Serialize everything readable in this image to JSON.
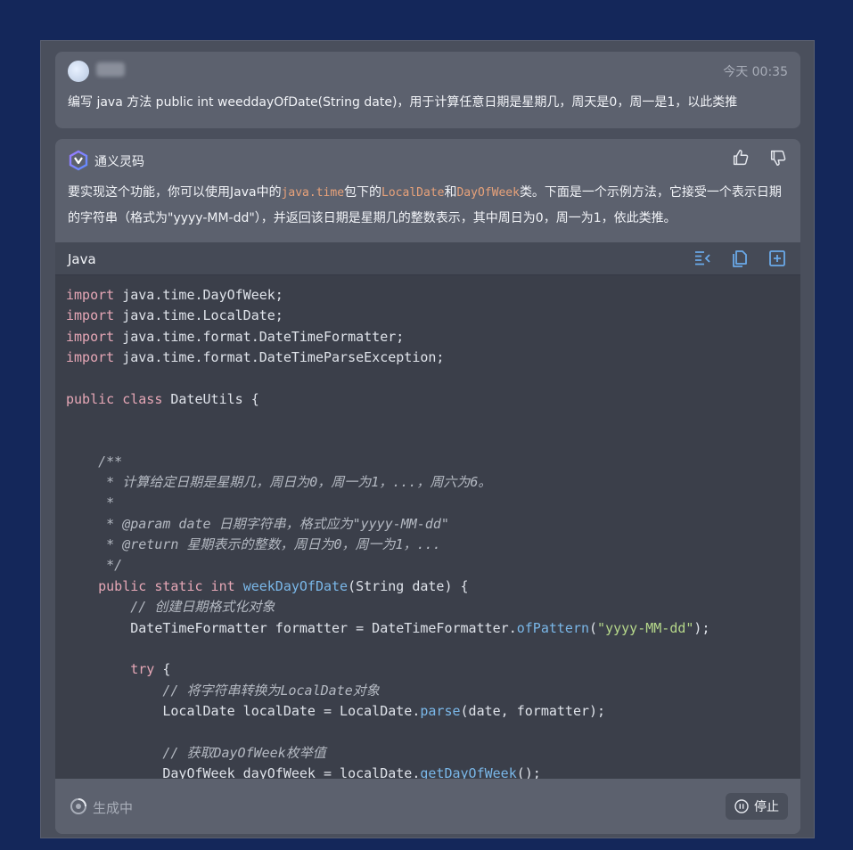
{
  "user_message": {
    "name": "",
    "time": "今天 00:35",
    "text": "编写 java 方法 public int weeddayOfDate(String date)，用于计算任意日期是星期几，周天是0，周一是1，以此类推"
  },
  "assistant_message": {
    "name": "通义灵码",
    "intro": {
      "p1": "要实现这个功能，你可以使用Java中的",
      "c1": "java.time",
      "p2": "包下的",
      "c2": "LocalDate",
      "p3": "和",
      "c3": "DayOfWeek",
      "p4": "类。下面是一个示例方法，它接受一个表示日期的字符串（格式为\"yyyy-MM-dd\"），并返回该日期是星期几的整数表示，其中周日为0，周一为1，依此类推。"
    },
    "code": {
      "language": "Java",
      "lines": [
        [
          {
            "t": "kw",
            "v": "import"
          },
          {
            "t": "",
            "v": " java.time.DayOfWeek;"
          }
        ],
        [
          {
            "t": "kw",
            "v": "import"
          },
          {
            "t": "",
            "v": " java.time.LocalDate;"
          }
        ],
        [
          {
            "t": "kw",
            "v": "import"
          },
          {
            "t": "",
            "v": " java.time.format.DateTimeFormatter;"
          }
        ],
        [
          {
            "t": "kw",
            "v": "import"
          },
          {
            "t": "",
            "v": " java.time.format.DateTimeParseException;"
          }
        ],
        [],
        [
          {
            "t": "kw",
            "v": "public class"
          },
          {
            "t": "",
            "v": " DateUtils {"
          }
        ],
        [],
        [],
        [
          {
            "t": "cm",
            "v": "    /**"
          }
        ],
        [
          {
            "t": "cm",
            "v": "     * 计算给定日期是星期几，周日为0，周一为1，...，周六为6。"
          }
        ],
        [
          {
            "t": "cm",
            "v": "     *"
          }
        ],
        [
          {
            "t": "cm",
            "v": "     * @param date 日期字符串，格式应为\"yyyy-MM-dd\""
          }
        ],
        [
          {
            "t": "cm",
            "v": "     * @return 星期表示的整数，周日为0，周一为1，..."
          }
        ],
        [
          {
            "t": "cm",
            "v": "     */"
          }
        ],
        [
          {
            "t": "kw",
            "v": "    public static int"
          },
          {
            "t": "",
            "v": " "
          },
          {
            "t": "fn",
            "v": "weekDayOfDate"
          },
          {
            "t": "",
            "v": "(String date) {"
          }
        ],
        [
          {
            "t": "cm",
            "v": "        // 创建日期格式化对象"
          }
        ],
        [
          {
            "t": "",
            "v": "        DateTimeFormatter formatter = DateTimeFormatter."
          },
          {
            "t": "fn",
            "v": "ofPattern"
          },
          {
            "t": "",
            "v": "("
          },
          {
            "t": "st",
            "v": "\"yyyy-MM-dd\""
          },
          {
            "t": "",
            "v": ");"
          }
        ],
        [],
        [
          {
            "t": "kw",
            "v": "        try"
          },
          {
            "t": "",
            "v": " {"
          }
        ],
        [
          {
            "t": "cm",
            "v": "            // 将字符串转换为LocalDate对象"
          }
        ],
        [
          {
            "t": "",
            "v": "            LocalDate localDate = LocalDate."
          },
          {
            "t": "fn",
            "v": "parse"
          },
          {
            "t": "",
            "v": "(date, formatter);"
          }
        ],
        [],
        [
          {
            "t": "cm",
            "v": "            // 获取DayOfWeek枚举值"
          }
        ],
        [
          {
            "t": "",
            "v": "            DayOfWeek dayOfWeek = localDate."
          },
          {
            "t": "fn",
            "v": "getDayOfWeek"
          },
          {
            "t": "",
            "v": "();"
          }
        ]
      ]
    }
  },
  "status": {
    "generating": "生成中",
    "stop_label": "停止"
  },
  "icons": [
    "user-avatar",
    "tongyi-logo-icon",
    "thumb-up-icon",
    "thumb-down-icon",
    "insert-icon",
    "copy-icon",
    "new-file-icon",
    "generating-icon",
    "stop-icon"
  ],
  "colors": {
    "keyword": "#e6a7b6",
    "function": "#7ab7e8",
    "string": "#b5d78a",
    "comment": "#b4b9c2",
    "inline_code": "#e8a27a"
  }
}
